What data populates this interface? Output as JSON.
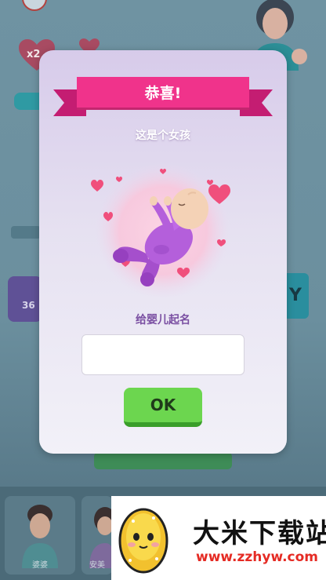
{
  "background": {
    "multiplier_badge": "x2",
    "left_card_value": "36",
    "right_button_letter": "Y",
    "bottom_cards": [
      "婆婆",
      "安美"
    ]
  },
  "dialog": {
    "title": "恭喜!",
    "subtitle": "这是个女孩",
    "name_prompt": "给婴儿起名",
    "name_input_value": "",
    "name_input_placeholder": "",
    "ok_label": "OK"
  },
  "watermark": {
    "title": "大米下载站",
    "url": "www.zzhyw.com"
  },
  "colors": {
    "ribbon": "#f0338b",
    "ribbon_dark": "#c41d72",
    "ok_button": "#6cd64f",
    "prompt_text": "#7a4fa2",
    "watermark_url": "#e52b24"
  },
  "icons": [
    "baby-illustration",
    "heart-icon",
    "watermark-logo-icon"
  ]
}
